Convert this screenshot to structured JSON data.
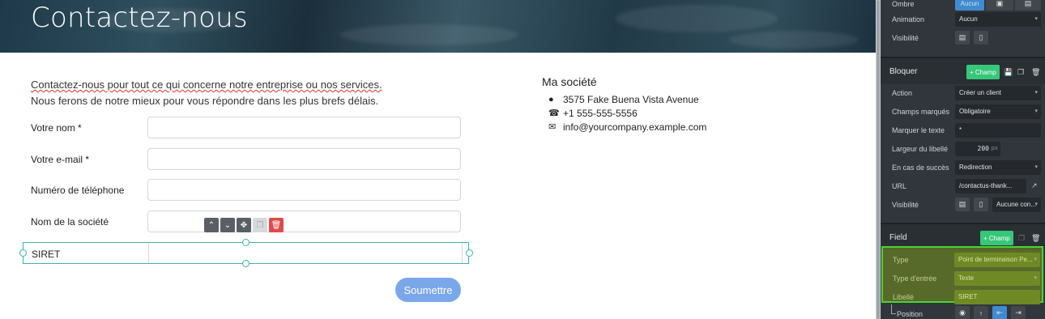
{
  "hero": {
    "title": "Contactez-nous"
  },
  "intro": {
    "line1": "Contactez-nous pour tout ce qui concerne notre entreprise ou nos services.",
    "line2": "Nous ferons de notre mieux pour vous répondre dans les plus brefs délais."
  },
  "form": {
    "fields": [
      {
        "label": "Votre nom *"
      },
      {
        "label": "Votre e-mail *"
      },
      {
        "label": "Numéro de téléphone"
      },
      {
        "label": "Nom de la société"
      }
    ],
    "selected_field": {
      "label": "SIRET"
    },
    "submit_label": "Soumettre"
  },
  "company": {
    "name": "Ma société",
    "address": "3575 Fake Buena Vista Avenue",
    "phone": "+1 555-555-5556",
    "email": "info@yourcompany.example.com"
  },
  "panel": {
    "top": {
      "ombre_label": "Ombre",
      "ombre_value": "Aucun",
      "animation_label": "Animation",
      "animation_value": "Aucun",
      "visibility_label": "Visibilité"
    },
    "block": {
      "title": "Bloquer",
      "add_field": "+ Champ",
      "action_label": "Action",
      "action_value": "Créer un client",
      "marked_label": "Champs marqués",
      "marked_value": "Obligatoire",
      "mark_text_label": "Marquer le texte",
      "mark_text_value": "*",
      "label_width_label": "Largeur du libellé",
      "label_width_value": "200",
      "label_width_unit": "px",
      "success_label": "En cas de succès",
      "success_value": "Redirection",
      "url_label": "URL",
      "url_value": "/contactus-thank...",
      "visibility_label": "Visibilité",
      "visibility_value": "Aucune con..."
    },
    "field": {
      "title": "Field",
      "add_field": "+ Champ",
      "type_label": "Type",
      "type_value": "Point de terminaison Pe...",
      "input_type_label": "Type d'entrée",
      "input_type_value": "Texte",
      "label_label": "Libellé",
      "label_value": "SIRET",
      "position_label": "Position"
    }
  },
  "colors": {
    "accent": "#3bb3b0",
    "submit": "#7aa7ea",
    "panel_bg": "#30363b",
    "add_button": "#37c77a",
    "highlight_border": "#4ad433",
    "delete": "#e04b4b"
  }
}
